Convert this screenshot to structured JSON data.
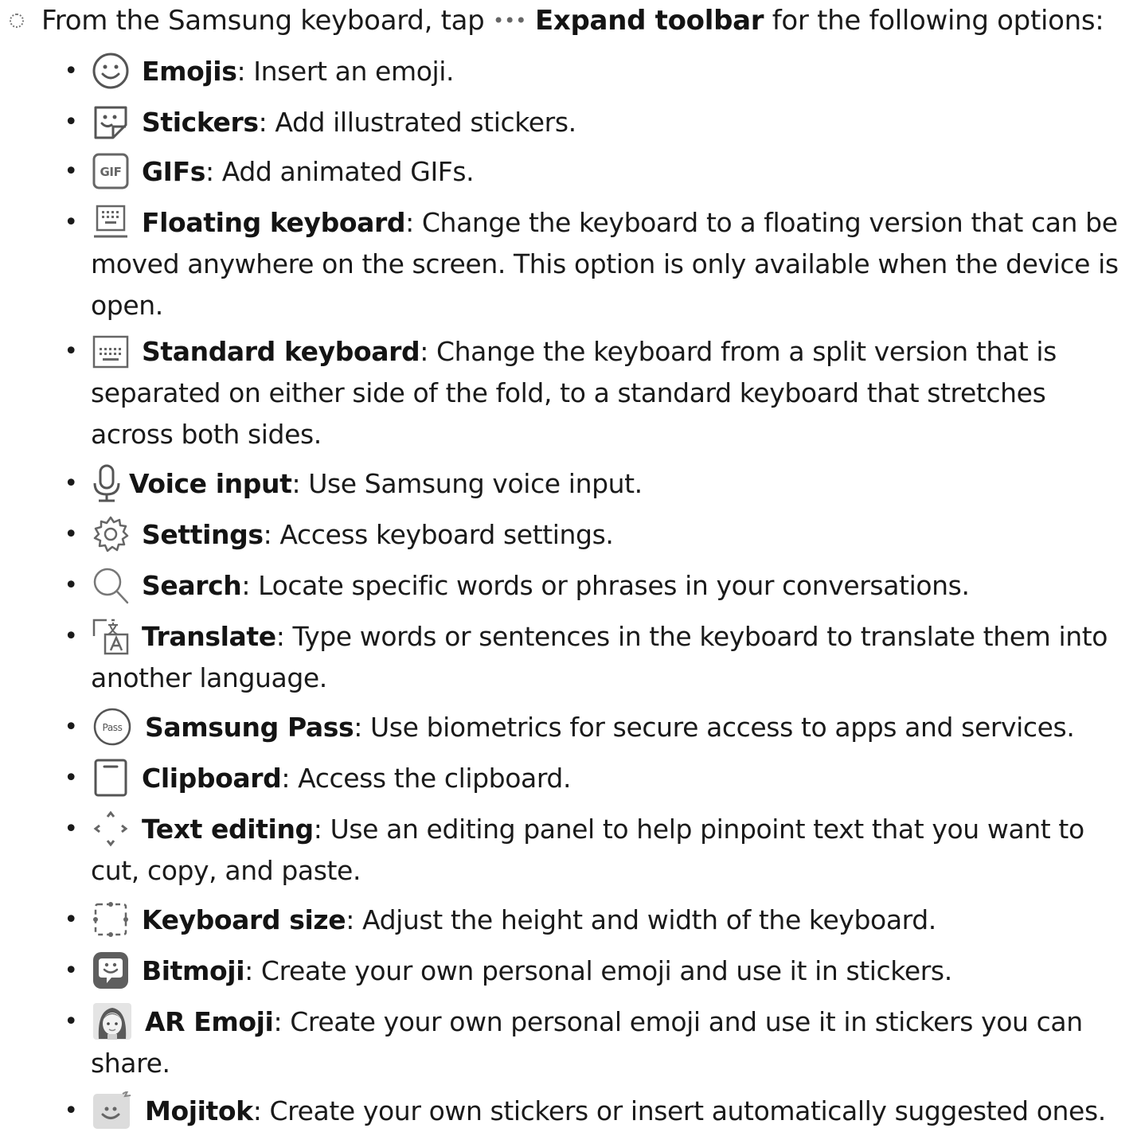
{
  "intro": {
    "prefix": "From the Samsung keyboard, tap ",
    "dots": "•••",
    "bold": "Expand toolbar",
    "suffix": " for the following options:"
  },
  "options": [
    {
      "icon": "emoji-icon",
      "label": "Emojis",
      "desc": ": Insert an emoji."
    },
    {
      "icon": "sticker-icon",
      "label": "Stickers",
      "desc": ": Add illustrated stickers."
    },
    {
      "icon": "gif-icon",
      "label": "GIFs",
      "desc": ": Add animated GIFs.",
      "icon_text": "GIF"
    },
    {
      "icon": "floating-keyboard-icon",
      "label": "Floating keyboard",
      "desc": ": Change the keyboard to a floating version that can be moved anywhere on the screen. This option is only available when the device is open."
    },
    {
      "icon": "standard-keyboard-icon",
      "label": "Standard keyboard",
      "desc": ": Change the keyboard from a split version that is separated on either side of the fold, to a standard keyboard that stretches across both sides."
    },
    {
      "icon": "microphone-icon",
      "label": "Voice input",
      "desc": ": Use Samsung voice input."
    },
    {
      "icon": "gear-icon",
      "label": "Settings",
      "desc": ": Access keyboard settings."
    },
    {
      "icon": "search-icon",
      "label": "Search",
      "desc": ": Locate specific words or phrases in your conversations."
    },
    {
      "icon": "translate-icon",
      "label": "Translate",
      "desc": ": Type words or sentences in the keyboard to translate them into another language."
    },
    {
      "icon": "samsung-pass-icon",
      "label": "Samsung Pass",
      "desc": ": Use biometrics for secure access to apps and services.",
      "icon_text": "Pass"
    },
    {
      "icon": "clipboard-icon",
      "label": "Clipboard",
      "desc": ": Access the clipboard."
    },
    {
      "icon": "text-editing-icon",
      "label": "Text editing",
      "desc": ": Use an editing panel to help pinpoint text that you want to cut, copy, and paste."
    },
    {
      "icon": "keyboard-size-icon",
      "label": "Keyboard size",
      "desc": ": Adjust the height and width of the keyboard."
    },
    {
      "icon": "bitmoji-icon",
      "label": "Bitmoji",
      "desc": ": Create your own personal emoji and use it in stickers."
    },
    {
      "icon": "ar-emoji-icon",
      "label": "AR Emoji",
      "desc": ": Create your own personal emoji and use it in stickers you can share."
    },
    {
      "icon": "mojitok-icon",
      "label": "Mojitok",
      "desc": ": Create your own stickers or insert automatically suggested ones."
    }
  ]
}
